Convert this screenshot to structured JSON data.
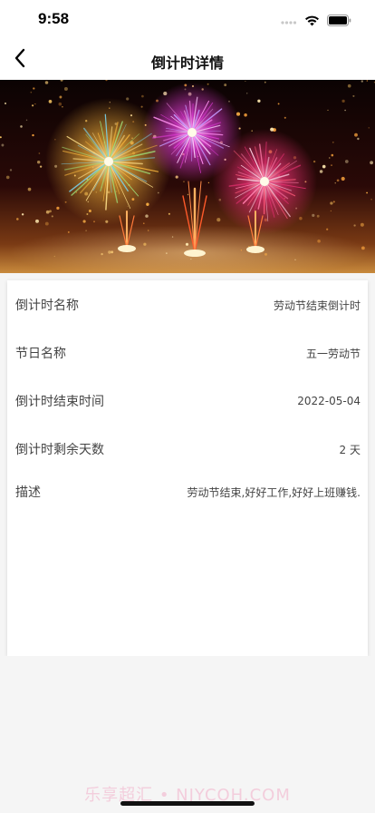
{
  "status_bar": {
    "time": "9:58"
  },
  "nav": {
    "title": "倒计时详情",
    "back_icon": "chevron-left-icon"
  },
  "hero": {
    "image": "fireworks"
  },
  "details": {
    "rows": [
      {
        "label": "倒计时名称",
        "value": "劳动节结束倒计时"
      },
      {
        "label": "节日名称",
        "value": "五一劳动节"
      },
      {
        "label": "倒计时结束时间",
        "value": "2022-05-04"
      },
      {
        "label": "倒计时剩余天数",
        "value": "2 天"
      },
      {
        "label": "描述",
        "value": "劳动节结束,好好工作,好好上班赚钱."
      }
    ]
  },
  "watermark": "乐享超汇 • NJYCOH.COM"
}
